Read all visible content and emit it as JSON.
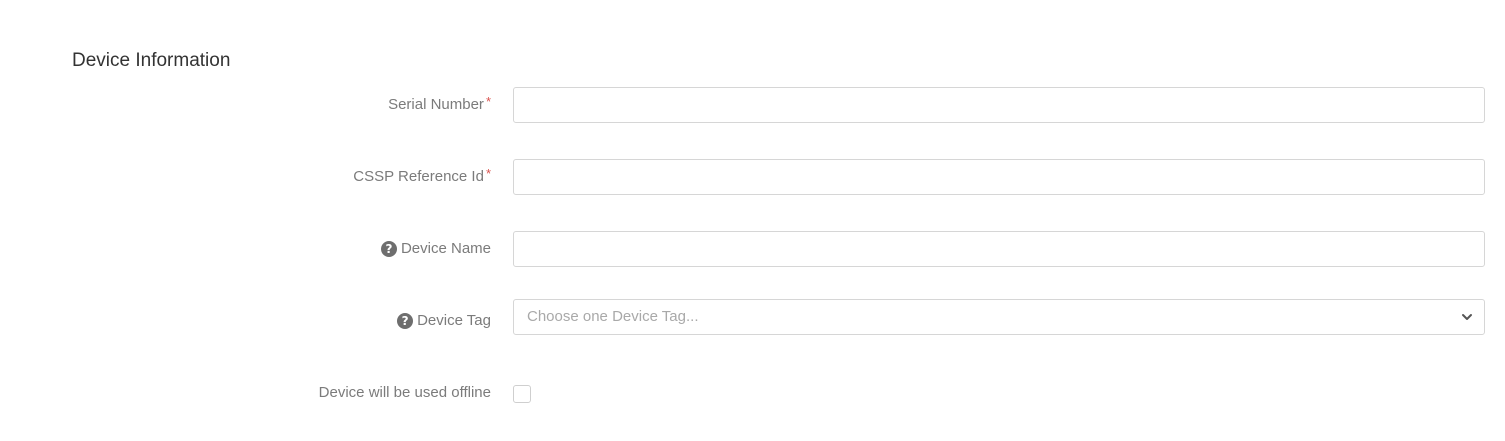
{
  "section": {
    "title": "Device Information"
  },
  "fields": {
    "serial_number": {
      "label": "Serial Number",
      "required_marker": "*",
      "value": ""
    },
    "cssp_reference_id": {
      "label": "CSSP Reference Id",
      "required_marker": "*",
      "value": ""
    },
    "device_name": {
      "label": "Device Name",
      "help_icon": "question-circle-icon",
      "value": ""
    },
    "device_tag": {
      "label": "Device Tag",
      "help_icon": "question-circle-icon",
      "placeholder": "Choose one Device Tag...",
      "dropdown_icon": "chevron-down-icon"
    },
    "offline": {
      "label": "Device will be used offline",
      "checked": false
    }
  },
  "colors": {
    "label_text": "#7b7b7b",
    "required_star": "#d9534f",
    "input_border": "#d6d6d6",
    "placeholder_text": "#a9a9a9",
    "title_text": "#333333"
  }
}
